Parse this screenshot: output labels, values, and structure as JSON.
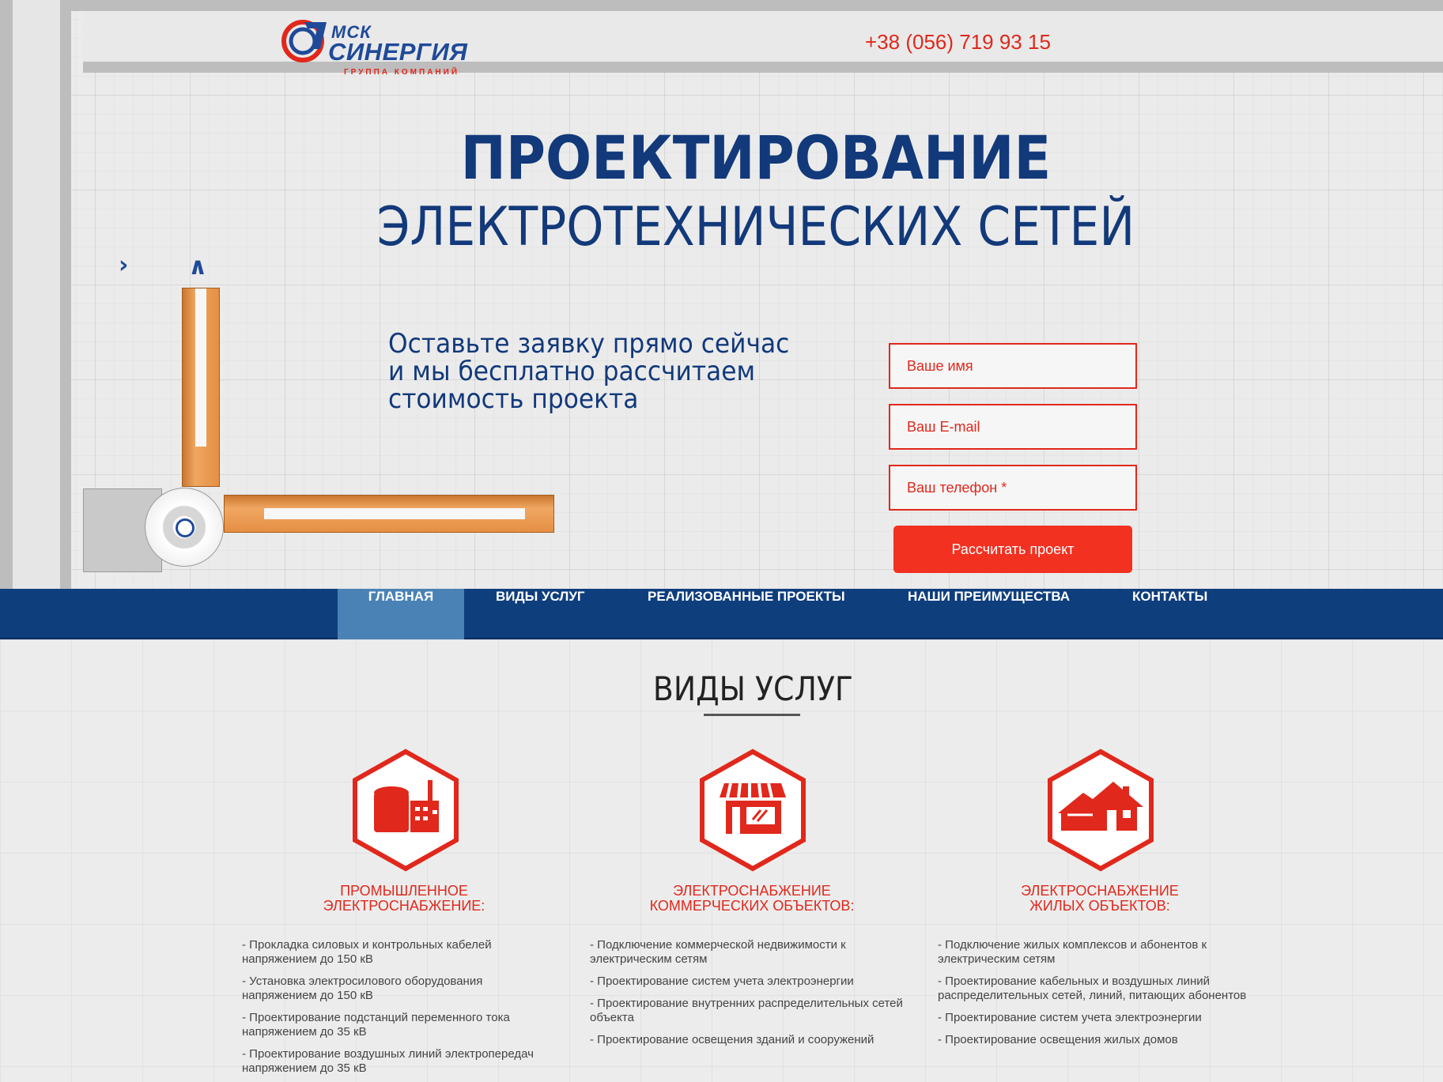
{
  "header": {
    "logo": {
      "line1": "МСК",
      "line2": "СИНЕРГИЯ",
      "tagline": "ГРУППА КОМПАНИЙ"
    },
    "phone": "+38 (056) 719 93 15"
  },
  "hero": {
    "title_line1": "ПРОЕКТИРОВАНИЕ",
    "title_line2": "ЭЛЕКТРОТЕХНИЧЕСКИХ СЕТЕЙ",
    "cta_lines": [
      "Оставьте заявку прямо сейчас",
      "и мы бесплатно рассчитаем",
      "стоимость проекта"
    ],
    "form": {
      "name_placeholder": "Ваше имя",
      "email_placeholder": "Ваш E-mail",
      "phone_placeholder": "Ваш телефон *",
      "submit_label": "Рассчитать проект"
    }
  },
  "nav": {
    "items": [
      {
        "label": "ГЛАВНАЯ",
        "active": true
      },
      {
        "label": "ВИДЫ УСЛУГ",
        "active": false
      },
      {
        "label": "РЕАЛИЗОВАННЫЕ ПРОЕКТЫ",
        "active": false
      },
      {
        "label": "НАШИ ПРЕИМУЩЕСТВА",
        "active": false
      },
      {
        "label": "КОНТАКТЫ",
        "active": false
      }
    ]
  },
  "services": {
    "title": "ВИДЫ УСЛУГ",
    "cards": [
      {
        "icon": "factory-icon",
        "title_line1": "ПРОМЫШЛЕННОЕ",
        "title_line2": "ЭЛЕКТРОСНАБЖЕНИЕ:",
        "items": [
          "- Прокладка силовых и контрольных кабелей напряжением до 150 кВ",
          "- Установка электросилового оборудования напряжением до 150 кВ",
          "- Проектирование подстанций переменного тока напряжением до 35 кВ",
          "- Проектирование воздушных линий электропередач напряжением до 35 кВ"
        ]
      },
      {
        "icon": "shop-icon",
        "title_line1": "ЭЛЕКТРОСНАБЖЕНИЕ",
        "title_line2": "КОММЕРЧЕСКИХ ОБЪЕКТОВ:",
        "items": [
          "- Подключение коммерческой недвижимости к электрическим сетям",
          "- Проектирование систем учета электроэнергии",
          "- Проектирование внутренних распределительных сетей объекта",
          "- Проектирование освещения зданий и сооружений"
        ]
      },
      {
        "icon": "house-icon",
        "title_line1": "ЭЛЕКТРОСНАБЖЕНИЕ",
        "title_line2": "ЖИЛЫХ ОБЪЕКТОВ:",
        "items": [
          "- Подключение жилых комплексов и абонентов к электрическим сетям",
          "- Проектирование кабельных и воздушных линий распределительных сетей, линий, питающих абонентов",
          "- Проектирование систем учета электроэнергии",
          "- Проектирование освещения жилых домов"
        ]
      }
    ]
  },
  "colors": {
    "brand_blue": "#12397a",
    "nav_blue": "#0f3e7d",
    "nav_active": "#4a82b6",
    "accent_red": "#e0281c",
    "button_red": "#f23121"
  }
}
